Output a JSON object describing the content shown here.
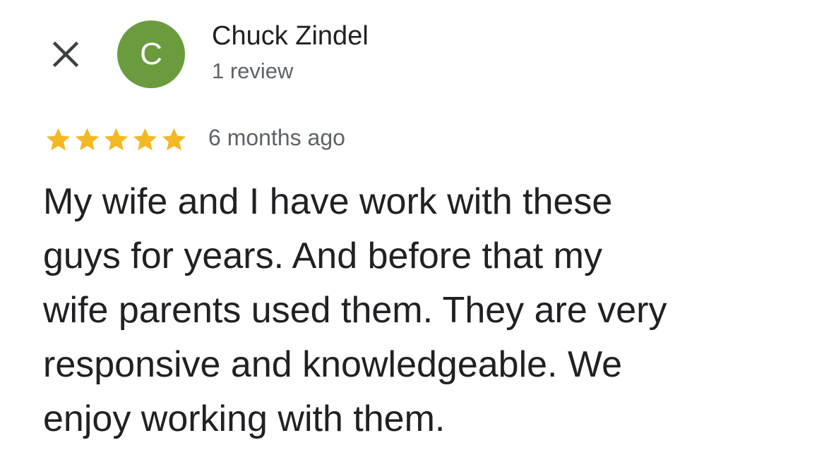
{
  "header": {
    "close_icon": "close-icon",
    "avatar": {
      "initial": "C",
      "color": "#6a9c3e"
    },
    "reviewer_name": "Chuck Zindel",
    "review_count": "1 review"
  },
  "review": {
    "rating": 5,
    "rating_max": 5,
    "star_color": "#f4b824",
    "date": "6 months ago",
    "text_lines": [
      "My wife and I have work with these",
      "guys for years.  And before that my",
      "wife parents used them.  They are very",
      "responsive and knowledgeable.  We",
      "enjoy working with them."
    ]
  }
}
